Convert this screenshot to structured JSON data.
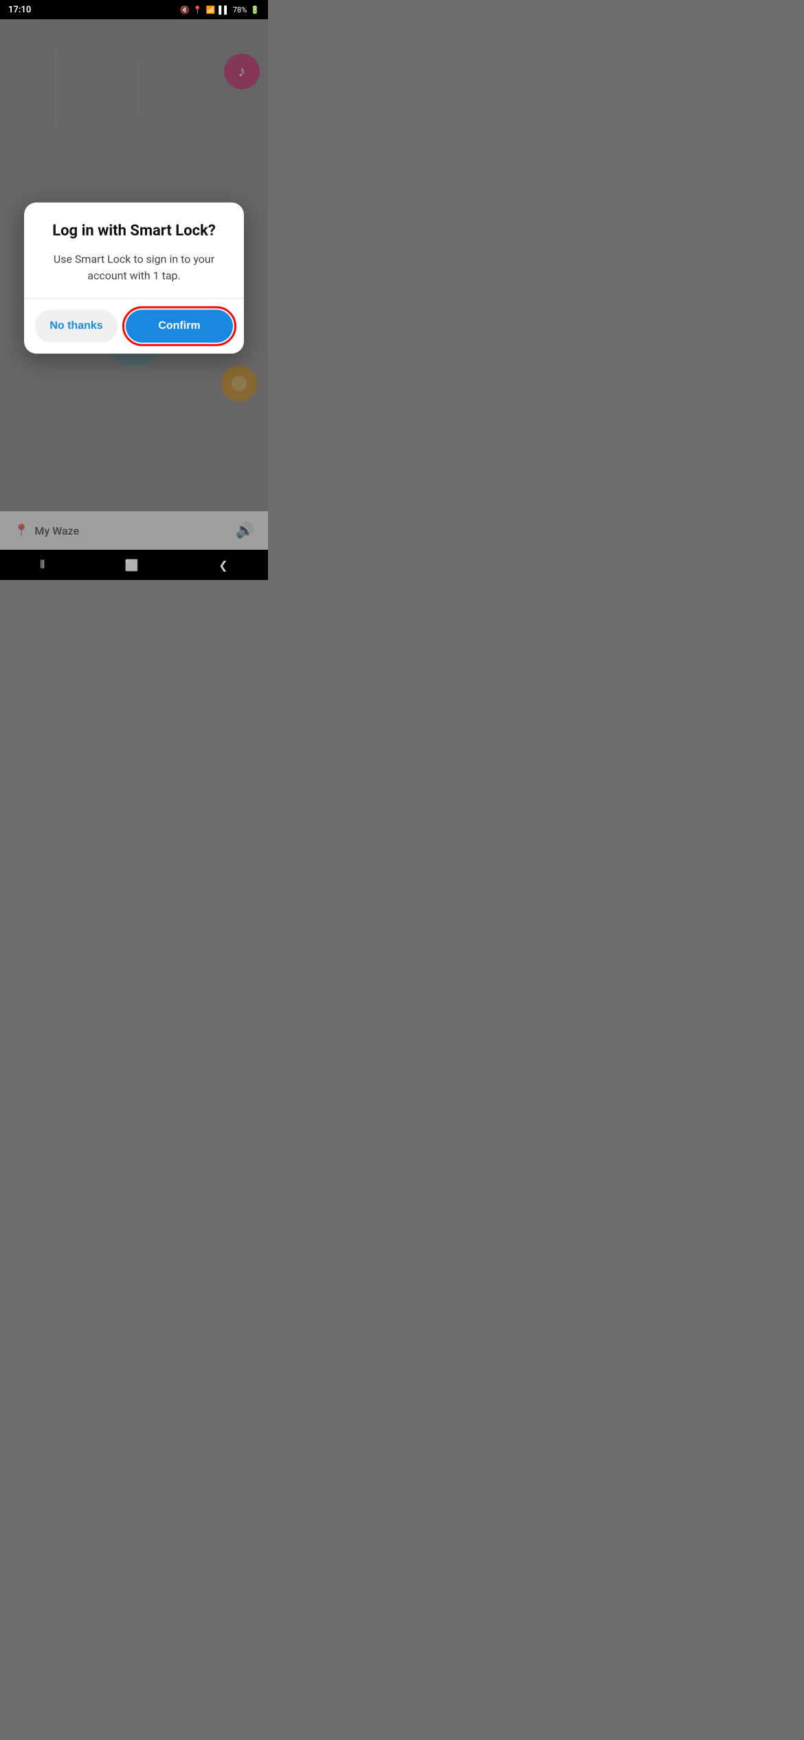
{
  "statusBar": {
    "time": "17:10",
    "battery": "78%"
  },
  "mapArea": {
    "bottomBarTitle": "My Waze"
  },
  "dialog": {
    "title": "Log in with Smart Lock?",
    "message": "Use Smart Lock to sign in to your account with 1 tap.",
    "noThanksLabel": "No thanks",
    "confirmLabel": "Confirm"
  },
  "navBar": {
    "backIcon": "❮",
    "homeIcon": "⬜",
    "recentsIcon": "⦀"
  }
}
